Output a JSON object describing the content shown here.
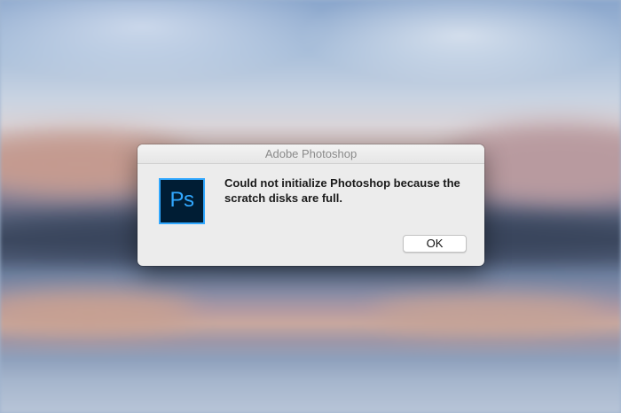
{
  "dialog": {
    "title": "Adobe Photoshop",
    "message": "Could not initialize Photoshop because the scratch disks are full.",
    "icon": "photoshop-app-icon",
    "icon_text": "Ps",
    "ok_label": "OK"
  },
  "colors": {
    "dialog_bg": "#ececec",
    "icon_bg": "#001d34",
    "icon_accent": "#31a8ff"
  }
}
